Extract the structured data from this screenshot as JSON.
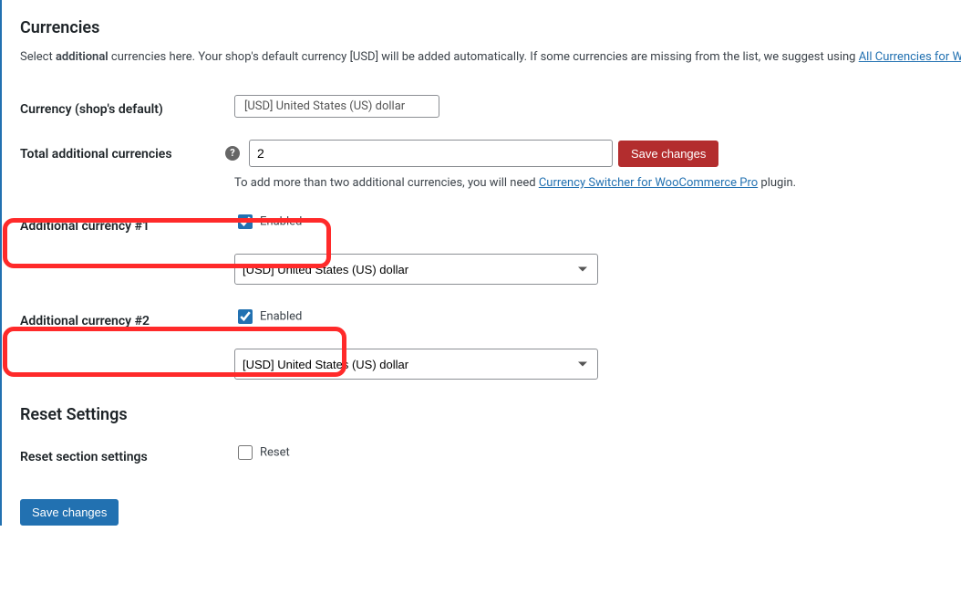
{
  "headings": {
    "currencies": "Currencies",
    "reset_settings": "Reset Settings"
  },
  "intro": {
    "pre": "Select ",
    "bold": "additional",
    "post": " currencies here. Your shop's default currency [USD] will be added automatically. If some currencies are missing from the list, we suggest using ",
    "link": "All Currencies for Wo"
  },
  "rows": {
    "default_label": "Currency (shop's default)",
    "default_value": "[USD] United States (US) dollar",
    "total_label": "Total additional currencies",
    "total_value": "2",
    "save_inline": "Save changes",
    "helper_pre": "To add more than two additional currencies, you will need ",
    "helper_link": "Currency Switcher for WooCommerce Pro",
    "helper_post": " plugin.",
    "addl1_label": "Additional currency #1",
    "addl2_label": "Additional currency #2",
    "enabled_text": "Enabled",
    "currency_option": "[USD] United States (US) dollar",
    "reset_section_label": "Reset section settings",
    "reset_text": "Reset"
  },
  "buttons": {
    "save_changes": "Save changes"
  }
}
